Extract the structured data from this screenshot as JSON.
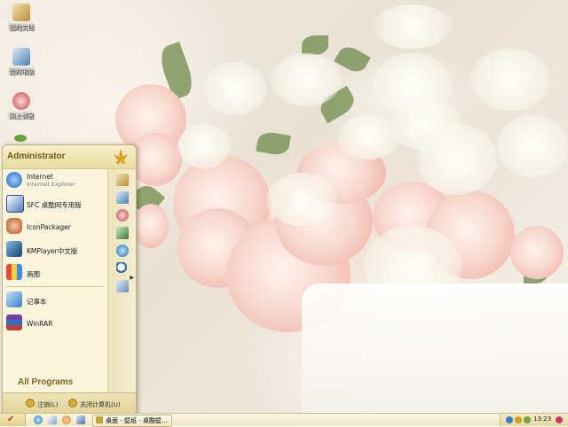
{
  "desktop": {
    "icons": [
      {
        "label": "我的文档",
        "icon": "my-documents-icon"
      },
      {
        "label": "我的电脑",
        "icon": "my-computer-icon"
      },
      {
        "label": "网上邻居",
        "icon": "network-icon"
      }
    ]
  },
  "start_menu": {
    "user": "Administrator",
    "items": [
      {
        "title": "Internet",
        "subtitle": "Internet Explorer",
        "icon": "internet-explorer-icon"
      },
      {
        "title": "SFC 桌酷网专用版",
        "icon": "sfc-icon"
      },
      {
        "title": "IconPackager",
        "icon": "iconpackager-icon"
      },
      {
        "title": "KMPlayer中文版",
        "icon": "kmplayer-icon"
      },
      {
        "title": "画图",
        "icon": "paint-icon"
      },
      {
        "title": "记事本",
        "icon": "notepad-icon"
      },
      {
        "title": "WinRAR",
        "icon": "winrar-icon"
      }
    ],
    "all_programs": "All Programs",
    "logoff": "注销(L)",
    "shutdown": "关闭计算机(U)"
  },
  "taskbar": {
    "task_label": "桌面 - 壁纸 - 桌酷壁...",
    "clock": "13:23"
  },
  "colors": {
    "menu_bg": "#fbf5dd",
    "menu_header": "#eadca0",
    "taskbar_bg": "#efe6c0",
    "accent_text": "#7a6720"
  }
}
